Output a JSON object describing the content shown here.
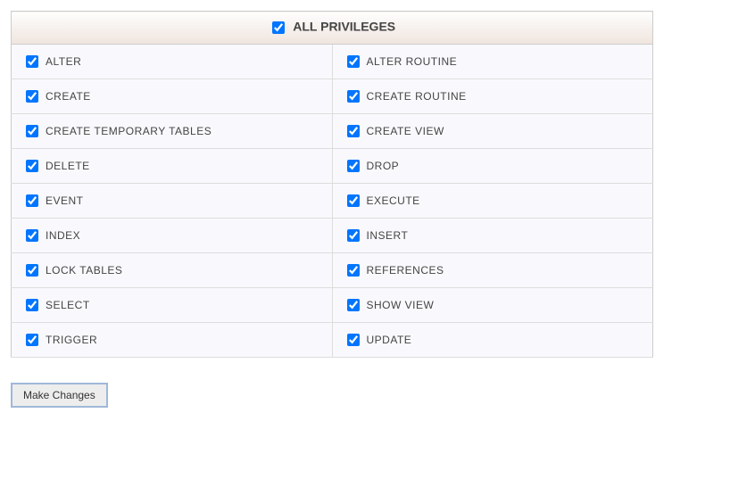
{
  "header": {
    "label": "ALL PRIVILEGES",
    "checked": true
  },
  "privileges": [
    {
      "left": {
        "label": "ALTER",
        "checked": true
      },
      "right": {
        "label": "ALTER ROUTINE",
        "checked": true
      }
    },
    {
      "left": {
        "label": "CREATE",
        "checked": true
      },
      "right": {
        "label": "CREATE ROUTINE",
        "checked": true
      }
    },
    {
      "left": {
        "label": "CREATE TEMPORARY TABLES",
        "checked": true
      },
      "right": {
        "label": "CREATE VIEW",
        "checked": true
      }
    },
    {
      "left": {
        "label": "DELETE",
        "checked": true
      },
      "right": {
        "label": "DROP",
        "checked": true
      }
    },
    {
      "left": {
        "label": "EVENT",
        "checked": true
      },
      "right": {
        "label": "EXECUTE",
        "checked": true
      }
    },
    {
      "left": {
        "label": "INDEX",
        "checked": true
      },
      "right": {
        "label": "INSERT",
        "checked": true
      }
    },
    {
      "left": {
        "label": "LOCK TABLES",
        "checked": true
      },
      "right": {
        "label": "REFERENCES",
        "checked": true
      }
    },
    {
      "left": {
        "label": "SELECT",
        "checked": true
      },
      "right": {
        "label": "SHOW VIEW",
        "checked": true
      }
    },
    {
      "left": {
        "label": "TRIGGER",
        "checked": true
      },
      "right": {
        "label": "UPDATE",
        "checked": true
      }
    }
  ],
  "button": {
    "label": "Make Changes"
  }
}
